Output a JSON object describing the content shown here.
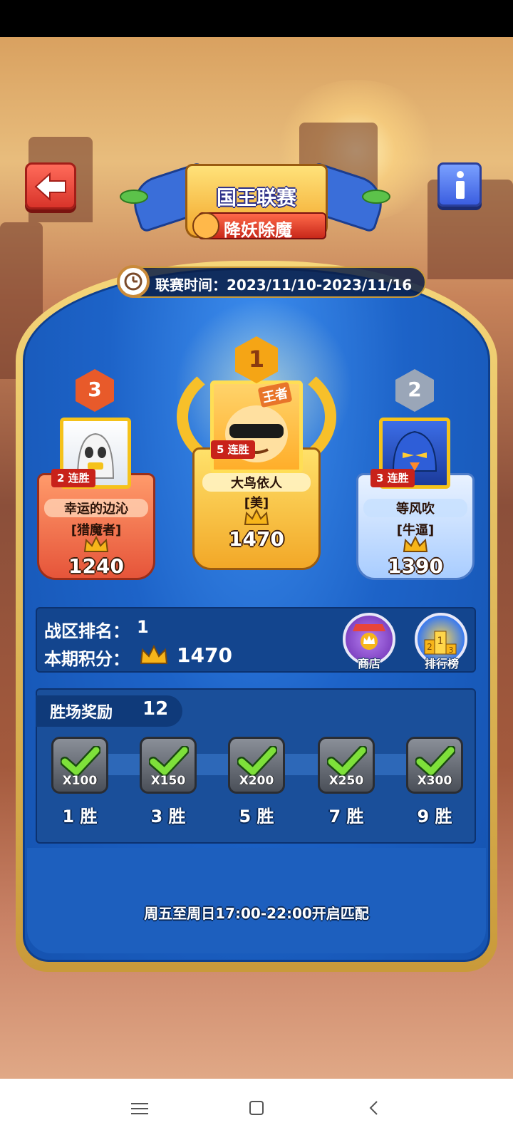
{
  "header": {
    "title": "国王联赛",
    "subtitle": "降妖除魔",
    "league_time": "联赛时间：2023/11/10-2023/11/16"
  },
  "podium": [
    {
      "rank": "3",
      "streak": "2 连胜",
      "name": "幸运的边沁",
      "guild": "[猎魔者]",
      "score": "1240"
    },
    {
      "rank": "1",
      "streak": "5 连胜",
      "name": "大鸟依人",
      "guild": "[美]",
      "score": "1470",
      "badge": "王者"
    },
    {
      "rank": "2",
      "streak": "3 连胜",
      "name": "等风吹",
      "guild": "[牛逼]",
      "score": "1390"
    }
  ],
  "stats": {
    "zone_rank_label": "战区排名：",
    "zone_rank_value": "1",
    "period_score_label": "本期积分：",
    "period_score_value": "1470",
    "shop_label": "商店",
    "leaderboard_label": "排行榜"
  },
  "wins_reward": {
    "label": "胜场奖励",
    "value": "12",
    "items": [
      {
        "amount": "X100",
        "wins": "1 胜",
        "claimed": true
      },
      {
        "amount": "X150",
        "wins": "3 胜",
        "claimed": true
      },
      {
        "amount": "X200",
        "wins": "5 胜",
        "claimed": true
      },
      {
        "amount": "X250",
        "wins": "7 胜",
        "claimed": true
      },
      {
        "amount": "X300",
        "wins": "9 胜",
        "claimed": true
      }
    ]
  },
  "match_info": "周五至周日17:00-22:00开启匹配",
  "icons": {
    "back": "back-arrow-icon",
    "info": "info-icon",
    "clock": "clock-icon",
    "crown": "crown-icon",
    "check": "check-icon",
    "nav": [
      "menu-icon",
      "home-icon",
      "back-icon"
    ]
  },
  "colors": {
    "panel_blue": "#1d63c8",
    "gold": "#f2a828",
    "red": "#d8342a",
    "check_green": "#7ee03a"
  }
}
